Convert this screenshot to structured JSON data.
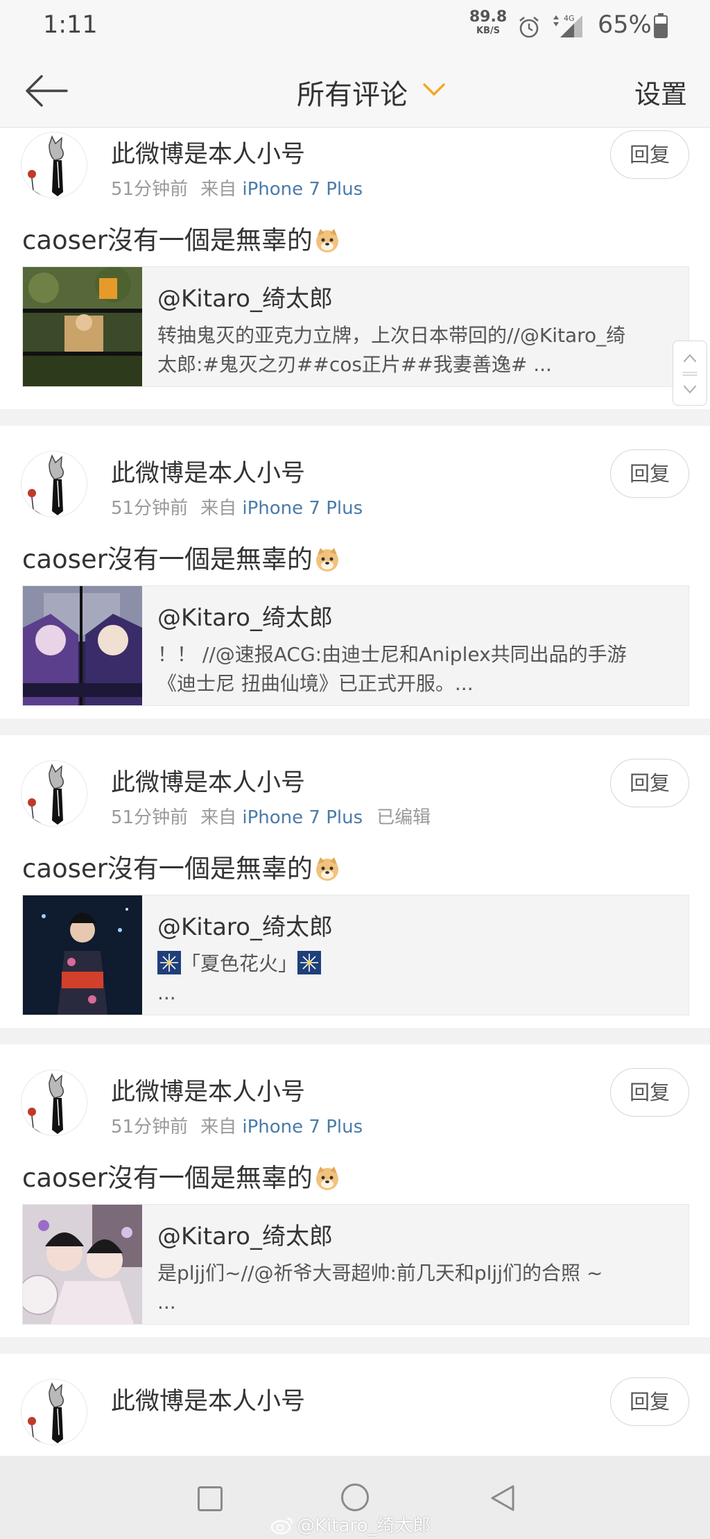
{
  "status_bar": {
    "time": "1:11",
    "net_speed": "89.8",
    "net_unit": "KB/S",
    "network_type": "4G",
    "battery": "65%"
  },
  "header": {
    "title": "所有评论",
    "settings_label": "设置"
  },
  "comments": [
    {
      "username": "此微博是本人小号",
      "time": "51分钟前",
      "from": "来自",
      "device": "iPhone 7 Plus",
      "edited": "",
      "reply_label": "回复",
      "text": "caoser沒有一個是無辜的",
      "emoji": "doge-emoji",
      "repost_author": "@Kitaro_绮太郎",
      "repost_line1": "转抽鬼灭的亚克力立牌，上次日本带回的//@Kitaro_绮",
      "repost_line2": "太郎:#鬼灭之刃##cos正片##我妻善逸# ..."
    },
    {
      "username": "此微博是本人小号",
      "time": "51分钟前",
      "from": "来自",
      "device": "iPhone 7 Plus",
      "edited": "",
      "reply_label": "回复",
      "text": "caoser沒有一個是無辜的",
      "emoji": "doge-emoji",
      "repost_author": "@Kitaro_绮太郎",
      "repost_line1": "！！ //@速报ACG:由迪士尼和Aniplex共同出品的手游",
      "repost_line2": "《迪士尼 扭曲仙境》已正式开服。..."
    },
    {
      "username": "此微博是本人小号",
      "time": "51分钟前",
      "from": "来自",
      "device": "iPhone 7 Plus",
      "edited": "已编辑",
      "reply_label": "回复",
      "text": "caoser沒有一個是無辜的",
      "emoji": "doge-emoji",
      "repost_author": "@Kitaro_绮太郎",
      "repost_line1": "「夏色花火」",
      "repost_line2": "..."
    },
    {
      "username": "此微博是本人小号",
      "time": "51分钟前",
      "from": "来自",
      "device": "iPhone 7 Plus",
      "edited": "",
      "reply_label": "回复",
      "text": "caoser沒有一個是無辜的",
      "emoji": "doge-emoji",
      "repost_author": "@Kitaro_绮太郎",
      "repost_line1": "是pljj们~//@祈爷大哥超帅:前几天和pljj们的合照 ~",
      "repost_line2": "..."
    },
    {
      "username": "此微博是本人小号",
      "reply_label": "回复"
    }
  ],
  "watermark": "@Kitaro_绮太郎",
  "colors": {
    "accent_orange": "#f5a623",
    "device_link": "#4a7ba8",
    "background": "#f2f2f2"
  }
}
